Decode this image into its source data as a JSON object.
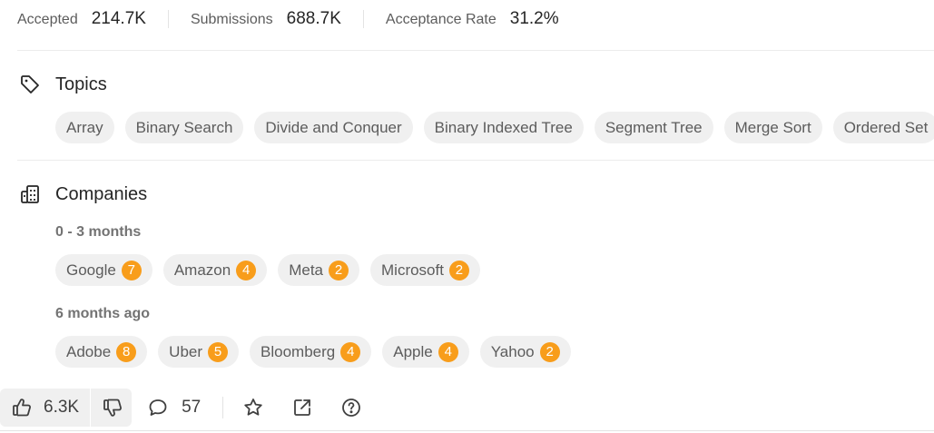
{
  "stats": [
    {
      "label": "Accepted",
      "value": "214.7K"
    },
    {
      "label": "Submissions",
      "value": "688.7K"
    },
    {
      "label": "Acceptance Rate",
      "value": "31.2%"
    }
  ],
  "topics": {
    "title": "Topics",
    "icon": "tag-icon",
    "tags": [
      "Array",
      "Binary Search",
      "Divide and Conquer",
      "Binary Indexed Tree",
      "Segment Tree",
      "Merge Sort",
      "Ordered Set"
    ]
  },
  "companies": {
    "title": "Companies",
    "icon": "building-icon",
    "groups": [
      {
        "label": "0 - 3 months",
        "items": [
          {
            "name": "Google",
            "count": "7"
          },
          {
            "name": "Amazon",
            "count": "4"
          },
          {
            "name": "Meta",
            "count": "2"
          },
          {
            "name": "Microsoft",
            "count": "2"
          }
        ]
      },
      {
        "label": "6 months ago",
        "items": [
          {
            "name": "Adobe",
            "count": "8"
          },
          {
            "name": "Uber",
            "count": "5"
          },
          {
            "name": "Bloomberg",
            "count": "4"
          },
          {
            "name": "Apple",
            "count": "4"
          },
          {
            "name": "Yahoo",
            "count": "2"
          }
        ]
      }
    ]
  },
  "toolbar": {
    "likes": "6.3K",
    "comments": "57",
    "icons": [
      "thumbs-up-icon",
      "thumbs-down-icon",
      "comment-icon",
      "star-icon",
      "share-icon",
      "help-icon"
    ]
  },
  "colors": {
    "badge": "#f89d1b",
    "chip_bg": "#f0f0f0",
    "text": "#262626",
    "muted": "#5c5c5c"
  }
}
